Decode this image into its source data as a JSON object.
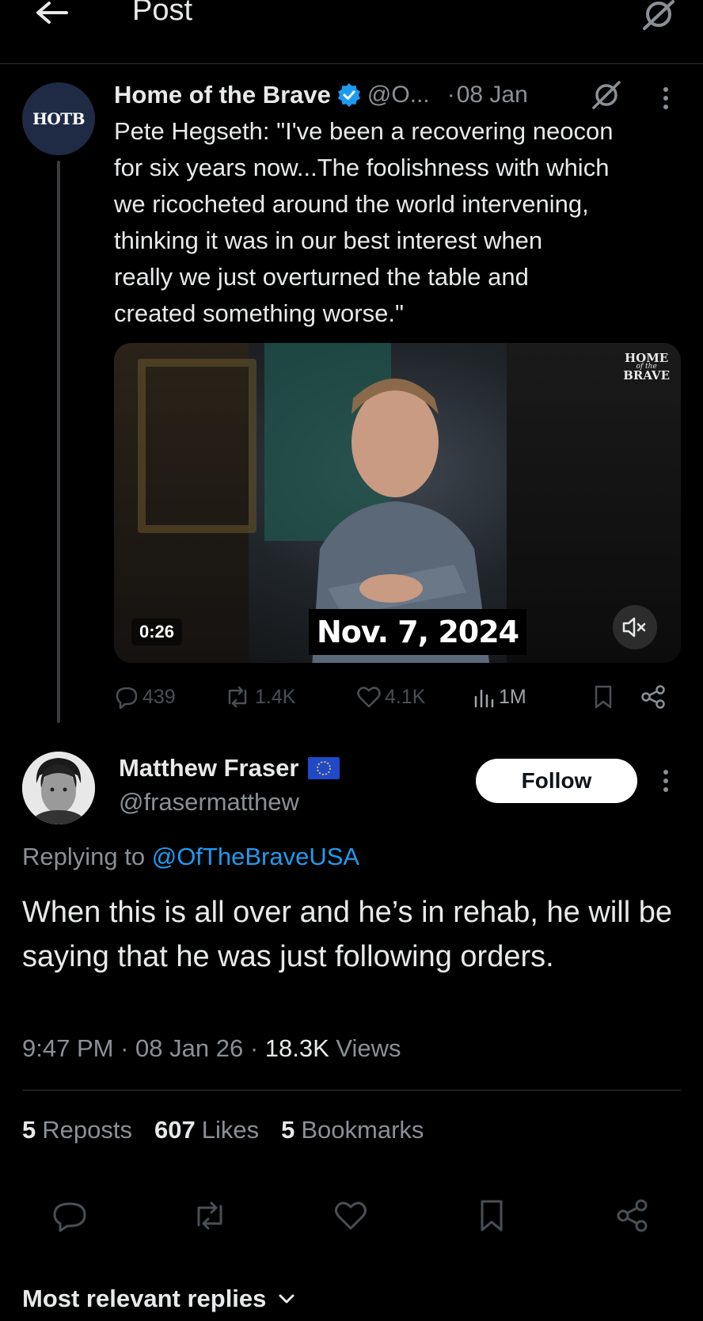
{
  "header": {
    "title": "Post",
    "back_icon": "arrow-left-icon",
    "grok_icon": "grok-icon"
  },
  "parent_tweet": {
    "avatar_text": "HOTB",
    "name": "Home of the Brave",
    "handle": "@O...",
    "separator": "·",
    "time": "08 Jan",
    "text": "Pete Hegseth: \"I've been a recovering neocon\nfor six years now...The foolishness with which\nwe ricocheted around the world intervening,\nthinking it was in our best interest when\nreally we just overturned the table and\ncreated something worse.\"",
    "video": {
      "watermark_line1": "HOME",
      "watermark_line2": "of the",
      "watermark_line3": "BRAVE",
      "duration": "0:26",
      "caption": "Nov. 7, 2024"
    },
    "actions": {
      "replies": "439",
      "reposts": "1.4K",
      "likes": "4.1K",
      "views": "1M"
    }
  },
  "reply": {
    "name": "Matthew Fraser",
    "handle": "@frasermatthew",
    "follow_label": "Follow",
    "replying_prefix": "Replying to",
    "replying_to": "@OfTheBraveUSA",
    "text": "When this is all over and he’s in rehab, he will be saying that he was just following orders.",
    "time": "9:47 PM",
    "date": "08 Jan 26",
    "sep": "·",
    "views_count": "18.3K",
    "views_label": "Views",
    "stats": [
      {
        "count": "5",
        "label": "Reposts"
      },
      {
        "count": "607",
        "label": "Likes"
      },
      {
        "count": "5",
        "label": "Bookmarks"
      }
    ]
  },
  "replies_sort": {
    "label": "Most relevant replies"
  },
  "colors": {
    "background": "#000000",
    "text": "#e7e9ea",
    "secondary": "#8b9096",
    "accent": "#1d9bf0",
    "verified": "#1d9bf0"
  }
}
